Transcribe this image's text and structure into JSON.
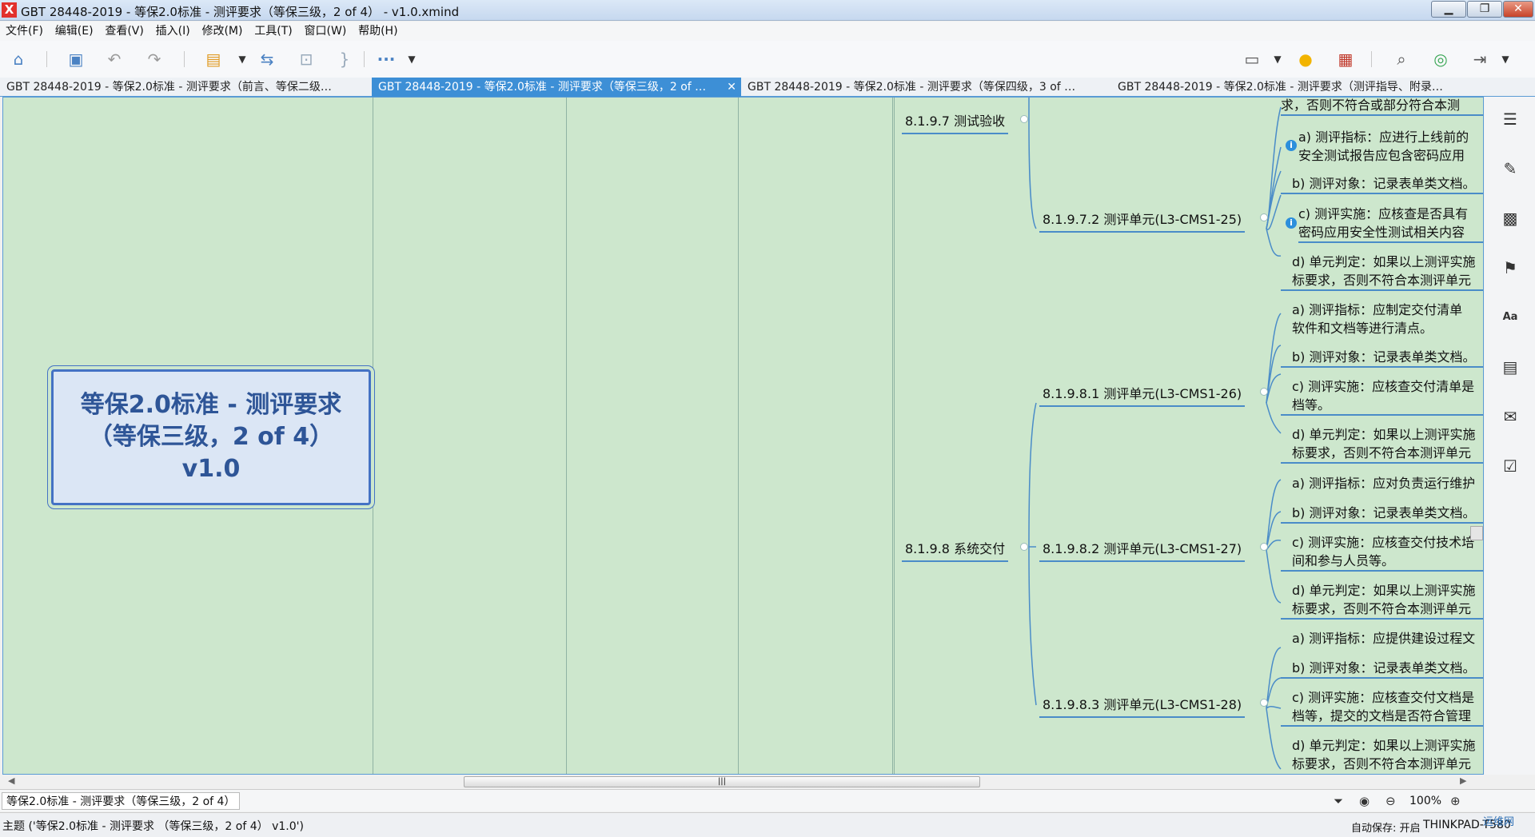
{
  "window": {
    "title": "GBT 28448-2019 - 等保2.0标准 - 测评要求（等保三级，2 of 4） - v1.0.xmind",
    "app_icon": "X",
    "minimize": "▁",
    "maximize": "❐",
    "close": "✕"
  },
  "menu": [
    "文件(F)",
    "编辑(E)",
    "查看(V)",
    "插入(I)",
    "修改(M)",
    "工具(T)",
    "窗口(W)",
    "帮助(H)"
  ],
  "toolbar": {
    "icons": [
      "home-icon",
      "save-icon",
      "undo-icon",
      "redo-icon",
      "topic-icon",
      "relationship-icon",
      "boundary-icon",
      "summary-icon",
      "more-icon",
      "presentation-icon",
      "idea-icon",
      "gantt-icon",
      "search-icon",
      "share-icon",
      "export-icon"
    ]
  },
  "tabs": [
    {
      "label": "GBT 28448-2019 - 等保2.0标准 - 测评要求（前言、等保二级…",
      "active": false
    },
    {
      "label": "GBT 28448-2019 - 等保2.0标准 - 测评要求（等保三级，2 of …",
      "active": true
    },
    {
      "label": "GBT 28448-2019 - 等保2.0标准 - 测评要求（等保四级，3 of …",
      "active": false
    },
    {
      "label": "GBT 28448-2019 - 等保2.0标准 - 测评要求（测评指导、附录…",
      "active": false
    }
  ],
  "central_topic": {
    "line1": "等保2.0标准 - 测评要求",
    "line2": "（等保三级，2 of 4）",
    "line3": "v1.0"
  },
  "topics": {
    "t8197": "8.1.9.7 测试验收",
    "t8198": "8.1.9.8 系统交付",
    "t81972": "8.1.9.7.2 测评单元(L3-CMS1-25)",
    "t81981": "8.1.9.8.1 测评单元(L3-CMS1-26)",
    "t81982": "8.1.9.8.2 测评单元(L3-CMS1-27)",
    "t81983": "8.1.9.8.3 测评单元(L3-CMS1-28)"
  },
  "leaves": {
    "l0": "求，否则不符合或部分符合本测",
    "l1a": "a) 测评指标：应进行上线前的",
    "l1b": "安全测试报告应包含密码应用",
    "l2": "b) 测评对象：记录表单类文档。",
    "l3a": "c) 测评实施：应核查是否具有",
    "l3b": "密码应用安全性测试相关内容",
    "l4a": "d) 单元判定：如果以上测评实施",
    "l4b": "标要求，否则不符合本测评单元",
    "l5a": "a) 测评指标：应制定交付清单",
    "l5b": "软件和文档等进行清点。",
    "l6": "b) 测评对象：记录表单类文档。",
    "l7a": "c) 测评实施：应核查交付清单是",
    "l7b": "档等。",
    "l8a": "d) 单元判定：如果以上测评实施",
    "l8b": "标要求，否则不符合本测评单元",
    "l9": "a) 测评指标：应对负责运行维护",
    "l10": "b) 测评对象：记录表单类文档。",
    "l11a": "c) 测评实施：应核查交付技术培",
    "l11b": "间和参与人员等。",
    "l12a": "d) 单元判定：如果以上测评实施",
    "l12b": "标要求，否则不符合本测评单元",
    "l13": "a) 测评指标：应提供建设过程文",
    "l14": "b) 测评对象：记录表单类文档。",
    "l15a": "c) 测评实施：应核查交付文档是",
    "l15b": "档等，提交的文档是否符合管理",
    "l16a": "d) 单元判定：如果以上测评实施",
    "l16b": "标要求，否则不符合本测评单元"
  },
  "sidebar_icons": [
    "outline-icon",
    "format-icon",
    "image-icon",
    "marker-icon",
    "text-style-icon",
    "notes-icon",
    "comments-icon",
    "task-icon"
  ],
  "sheet_tab": "等保2.0标准 - 测评要求（等保三级，2 of 4）",
  "zoom": "100%",
  "status": {
    "topic": "主题 ('等保2.0标准 - 测评要求 （等保三级，2 of 4） v1.0')",
    "autosave": "自动保存: 开启",
    "machine": "THINKPAD-T580",
    "watermark": "运维网"
  }
}
